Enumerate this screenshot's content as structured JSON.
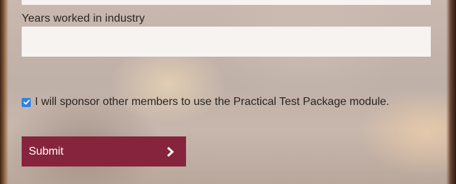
{
  "form": {
    "years_label": "Years worked in industry",
    "years_value": "",
    "sponsor_checkbox": {
      "checked": true,
      "label": "I will sponsor other members to use the Practical Test Package module."
    },
    "submit_label": "Submit",
    "submit_icon": "chevron-right-icon"
  },
  "colors": {
    "submit_bg": "#87243d",
    "checkbox_accent": "#2f7fe6",
    "field_bg": "#f6f3f1"
  }
}
